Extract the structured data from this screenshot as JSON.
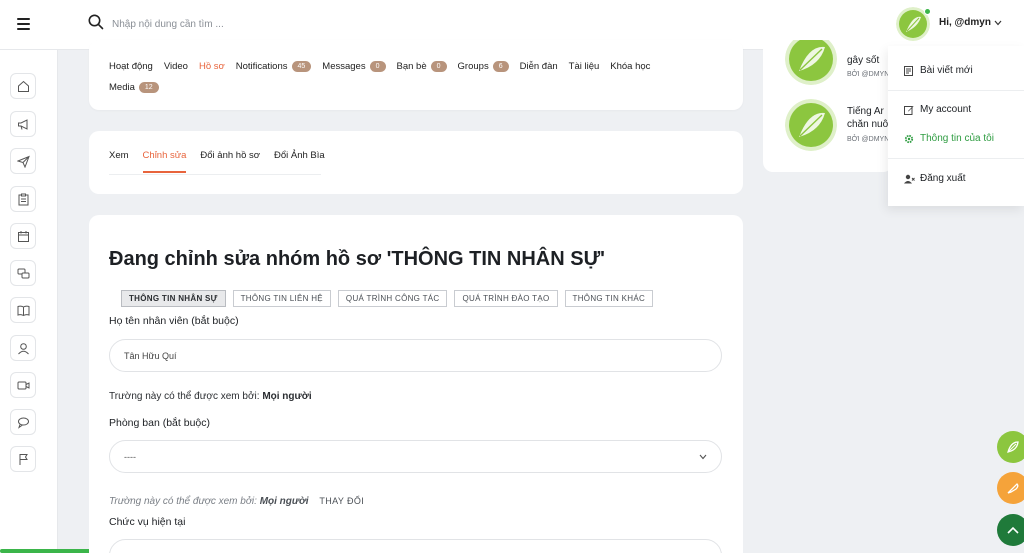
{
  "search": {
    "placeholder": "Nhập nội dung cần tìm ..."
  },
  "user": {
    "greeting": "Hi, @dmyn",
    "status_color": "#3bb54a"
  },
  "profile_nav": {
    "row1": [
      {
        "label": "Hoạt động",
        "badge": null,
        "active": false
      },
      {
        "label": "Video",
        "badge": null,
        "active": false
      },
      {
        "label": "Hồ sơ",
        "badge": null,
        "active": true
      },
      {
        "label": "Notifications",
        "badge": "45",
        "active": false
      },
      {
        "label": "Messages",
        "badge": "0",
        "active": false
      },
      {
        "label": "Bạn bè",
        "badge": "0",
        "active": false
      },
      {
        "label": "Groups",
        "badge": "6",
        "active": false
      },
      {
        "label": "Diễn đàn",
        "badge": null,
        "active": false
      },
      {
        "label": "Tài liệu",
        "badge": null,
        "active": false
      },
      {
        "label": "Khóa học",
        "badge": null,
        "active": false
      }
    ],
    "row2": [
      {
        "label": "Media",
        "badge": "12",
        "active": false
      }
    ]
  },
  "profile_subtabs": [
    {
      "label": "Xem",
      "active": false
    },
    {
      "label": "Chỉnh sửa",
      "active": true
    },
    {
      "label": "Đổi ảnh hồ sơ",
      "active": false
    },
    {
      "label": "Đổi Ảnh Bìa",
      "active": false
    }
  ],
  "form": {
    "title": "Đang chỉnh sửa nhóm hồ sơ 'THÔNG TIN NHÂN SỰ'",
    "groups": [
      {
        "label": "THÔNG TIN NHÂN SỰ",
        "active": true
      },
      {
        "label": "THÔNG TIN LIÊN HỆ",
        "active": false
      },
      {
        "label": "QUÁ TRÌNH CÔNG TÁC",
        "active": false
      },
      {
        "label": "QUÁ TRÌNH ĐÀO TẠO",
        "active": false
      },
      {
        "label": "THÔNG TIN KHÁC",
        "active": false
      }
    ],
    "employee_name": {
      "label": "Họ tên nhân viên (bắt buộc)",
      "value": "Tân Hữu Quí",
      "visibility_prefix": "Trường này có thể được xem bởi:",
      "visibility_value": "Mọi người"
    },
    "department": {
      "label": "Phòng ban (bắt buộc)",
      "selected": "----",
      "visibility_prefix": "Trường này có thể được xem bởi:",
      "visibility_value": "Mọi người",
      "change_label": "THAY ĐỔI"
    },
    "position": {
      "label": "Chức vụ hiện tại"
    }
  },
  "recent_posts": [
    {
      "title_lines": [
        "gây sốt"
      ],
      "by": "BỞI @DMYN"
    },
    {
      "title_lines": [
        "Tiếng Ar",
        "chăn nuô"
      ],
      "by": "BỞI @DMYN"
    }
  ],
  "user_menu": {
    "items": [
      {
        "label": "Bài viết mới",
        "icon": "document-icon",
        "active": false
      },
      {
        "label": "My account",
        "icon": "edit-icon",
        "active": false
      },
      {
        "label": "Thông tin của tôi",
        "icon": "gear-icon",
        "active": true
      },
      {
        "label": "Đăng xuất",
        "icon": "user-logout-icon",
        "active": false
      }
    ]
  },
  "colors": {
    "accent": "#e8643c",
    "badge": "#b8947c",
    "green": "#3bb54a",
    "fab_orange": "#f5a33a",
    "fab_dark_green": "#1f7a3a"
  }
}
